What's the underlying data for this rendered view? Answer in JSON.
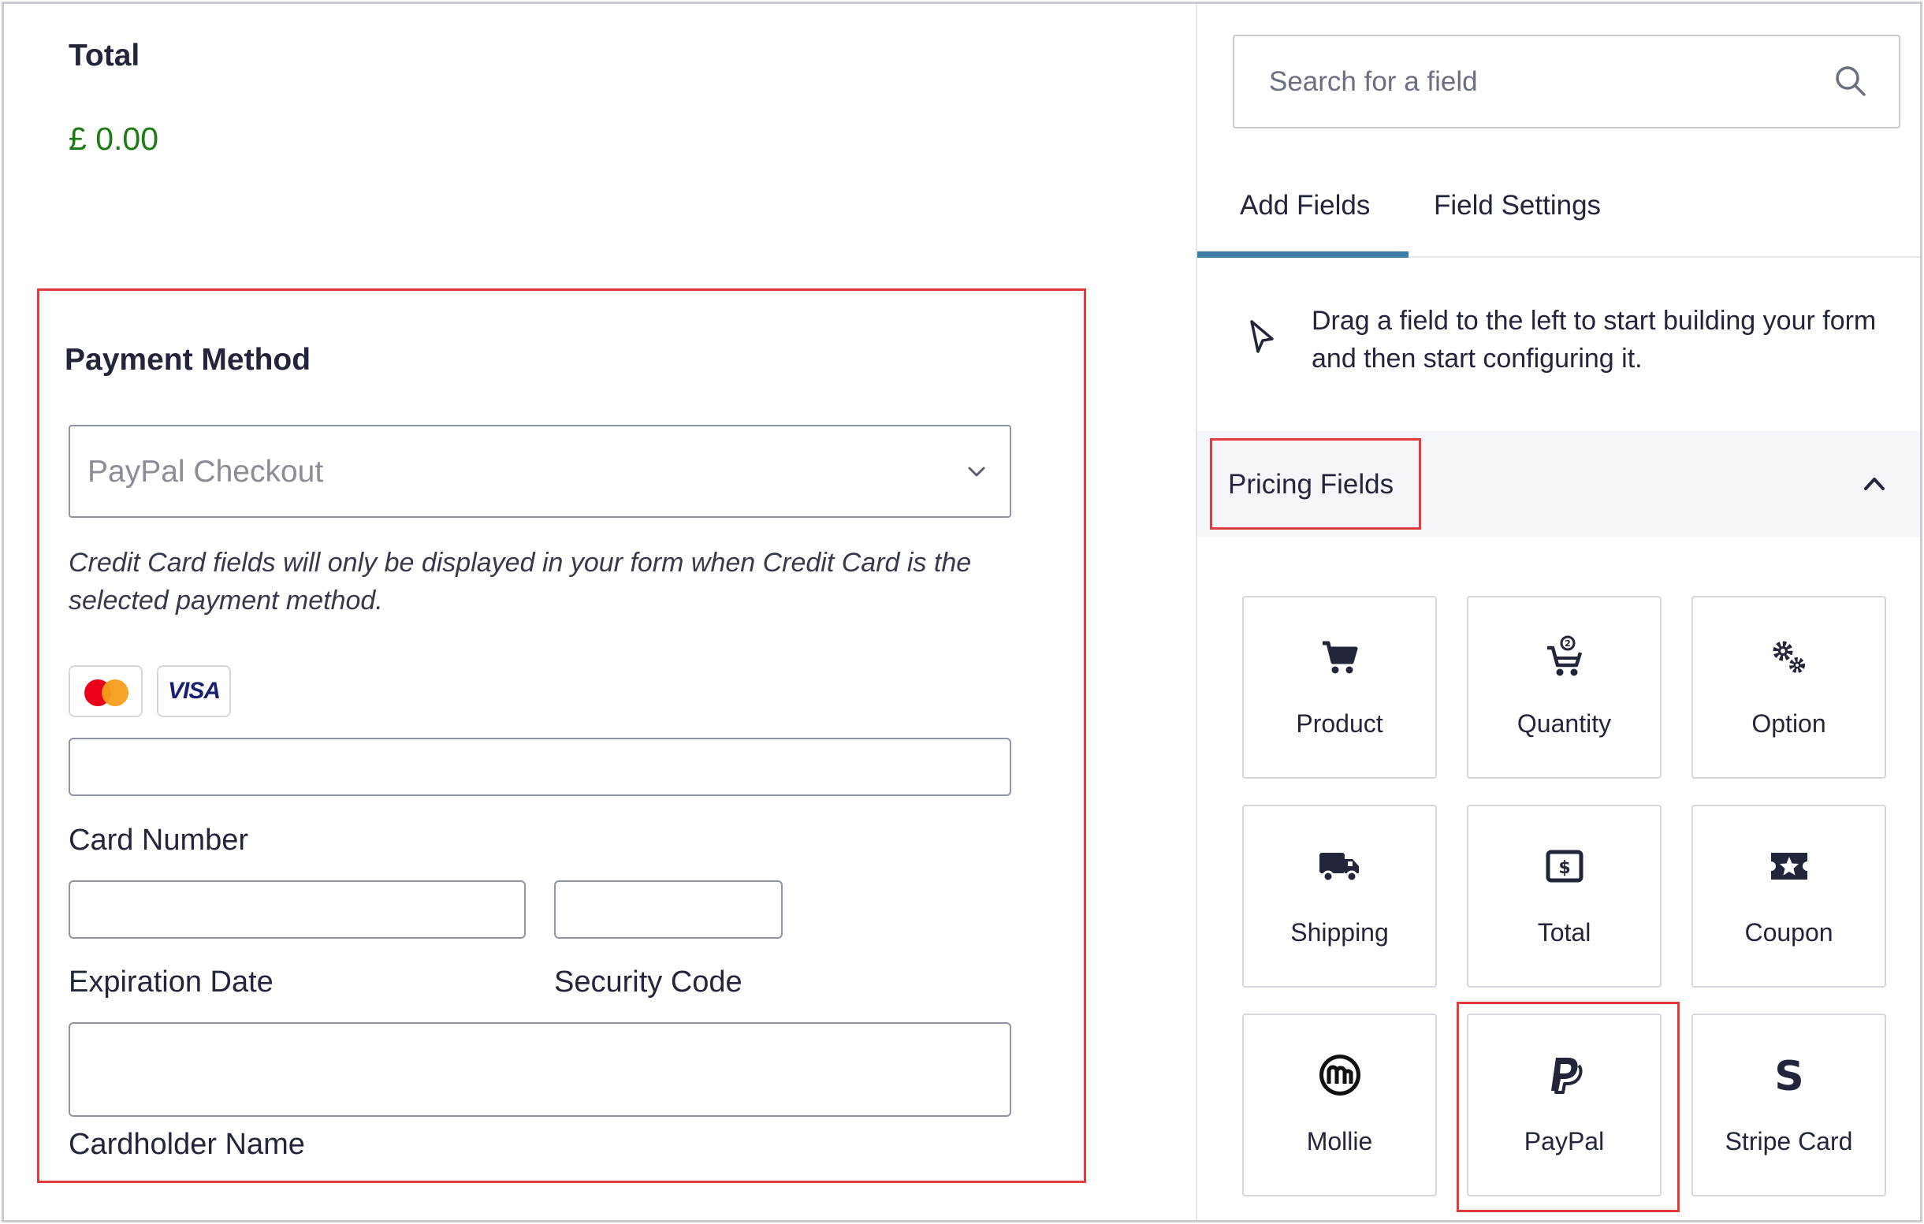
{
  "form": {
    "total_title": "Total",
    "total_value": "£ 0.00",
    "payment_title": "Payment Method",
    "payment_select_value": "PayPal Checkout",
    "payment_note": "Credit Card fields will only be displayed in your form when Credit Card is the selected payment method.",
    "card_logos": {
      "visa": "VISA"
    },
    "labels": {
      "card_number": "Card Number",
      "expiration": "Expiration Date",
      "security": "Security Code",
      "cardholder": "Cardholder Name"
    }
  },
  "sidebar": {
    "search_placeholder": "Search for a field",
    "tabs": [
      {
        "label": "Add Fields",
        "active": true
      },
      {
        "label": "Field Settings",
        "active": false
      }
    ],
    "hint": "Drag a field to the left to start building your form and then start configuring it.",
    "section_title": "Pricing Fields",
    "fields": [
      {
        "label": "Product",
        "icon": "cart-icon"
      },
      {
        "label": "Quantity",
        "icon": "cart-quantity-icon"
      },
      {
        "label": "Option",
        "icon": "gears-icon"
      },
      {
        "label": "Shipping",
        "icon": "truck-icon"
      },
      {
        "label": "Total",
        "icon": "dollar-receipt-icon"
      },
      {
        "label": "Coupon",
        "icon": "star-ticket-icon"
      },
      {
        "label": "Mollie",
        "icon": "mollie-icon"
      },
      {
        "label": "PayPal",
        "icon": "paypal-icon"
      },
      {
        "label": "Stripe Card",
        "icon": "stripe-icon"
      }
    ]
  },
  "colors": {
    "total_green": "#1d7a14",
    "highlight_red": "#e23b3b",
    "tab_underline": "#3e7da6",
    "text_dark": "#23263b"
  }
}
